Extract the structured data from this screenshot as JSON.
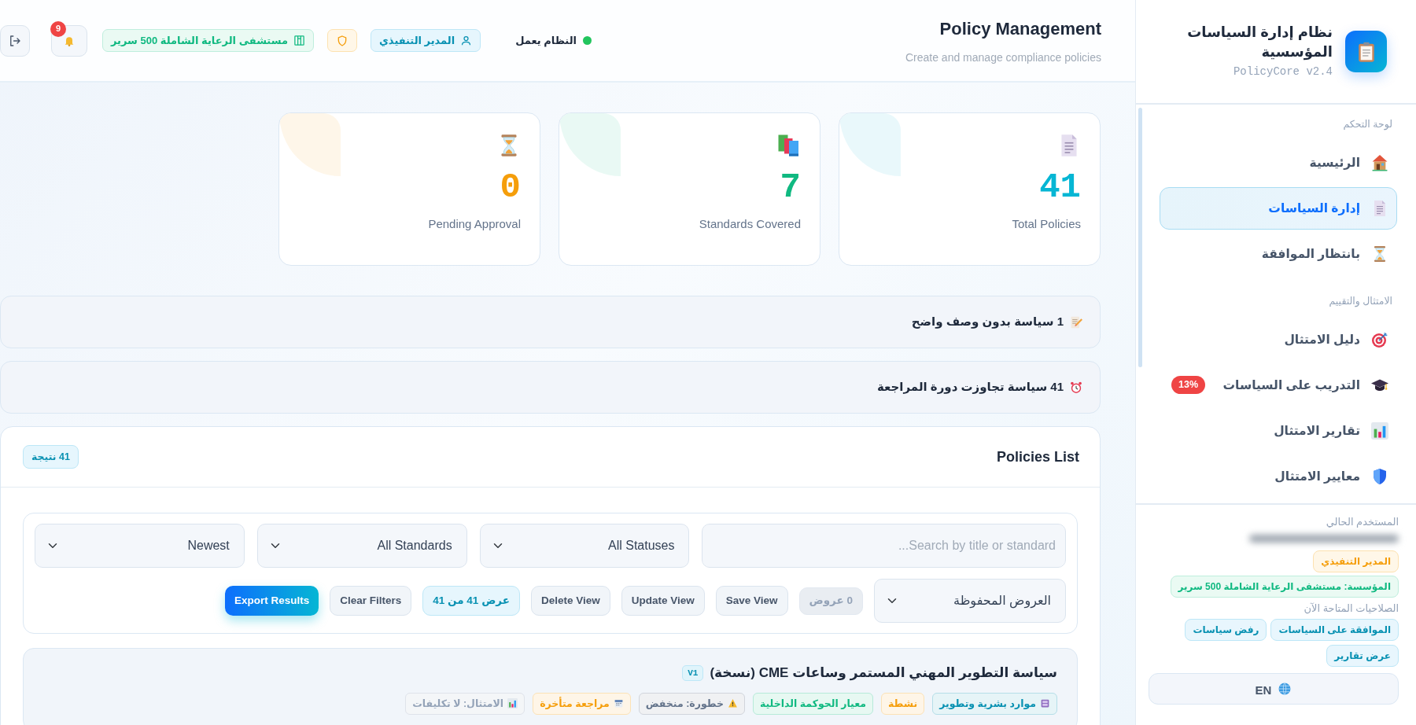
{
  "header": {
    "title": "Policy Management",
    "subtitle": "Create and manage compliance policies",
    "system_status": "النظام يعمل",
    "role": "المدير التنفيذي",
    "organization": "مستشفى الرعاية الشاملة 500 سرير",
    "notification_count": "9"
  },
  "sidebar": {
    "app_title": "نظام إدارة السياسات المؤسسية",
    "version": "PolicyCore v2.4",
    "sections": [
      {
        "label": "لوحة التحكم",
        "items": [
          {
            "label": "الرئيسية",
            "selected": false
          },
          {
            "label": "إدارة السياسات",
            "selected": true
          },
          {
            "label": "بانتظار الموافقة",
            "selected": false
          }
        ]
      },
      {
        "label": "الامتثال والتقييم",
        "items": [
          {
            "label": "دليل الامتثال",
            "selected": false
          },
          {
            "label": "التدريب على السياسات",
            "selected": false,
            "badge": "13%"
          },
          {
            "label": "تقارير الامتثال",
            "selected": false
          },
          {
            "label": "معايير الامتثال",
            "selected": false
          }
        ]
      }
    ],
    "user": {
      "heading": "المستخدم الحالي",
      "role": "المدير التنفيذي",
      "organization": "المؤسسة: مستشفى الرعاية الشاملة 500 سرير",
      "permissions_heading": "الصلاحيات المتاحة الآن",
      "permissions": [
        "الموافقة على السياسات",
        "رفض سياسات",
        "عرض تقارير"
      ],
      "language": "EN"
    }
  },
  "stats": [
    {
      "value": "41",
      "label": "Total Policies",
      "color": "#06b6d4"
    },
    {
      "value": "7",
      "label": "Standards Covered",
      "color": "#10b981"
    },
    {
      "value": "0",
      "label": "Pending Approval",
      "color": "#f59e0b"
    }
  ],
  "alerts": [
    "1 سياسة بدون وصف واضح",
    "41 سياسة تجاوزت دورة المراجعة"
  ],
  "policies_list": {
    "title": "Policies List",
    "count": "41 نتيجة",
    "filters": {
      "search": {
        "placeholder": "Search by title or standard..."
      },
      "status": "All Statuses",
      "standard": "All Standards",
      "sort": "Newest",
      "saved_views": "العروض المحفوظة",
      "views_count": "0 عروض",
      "buttons": [
        "Save View",
        "Update View",
        "Delete View"
      ],
      "results_count": "عرض 41 من 41",
      "clear": "Clear Filters",
      "export": "Export Results"
    },
    "policies": [
      {
        "title": "سياسة التطوير المهني المستمر وساعات CME (نسخة)",
        "version": "V1",
        "tags": [
          {
            "kind": "department",
            "label": "موارد بشرية وتطوير",
            "color": "#0891b2"
          },
          {
            "kind": "status",
            "label": "نشطة",
            "color": "#f59e0b"
          },
          {
            "kind": "standard",
            "label": "معيار الحوكمة الداخلية",
            "color": "#10b981"
          },
          {
            "kind": "risk",
            "label": "خطورة: منخفض",
            "color": "#64748b"
          },
          {
            "kind": "review",
            "label": "مراجعة متأخرة",
            "color": "#f59e0b"
          },
          {
            "kind": "compliance",
            "label": "الامتثال: لا تكليفات",
            "color": "#94a3b8"
          }
        ]
      }
    ]
  }
}
